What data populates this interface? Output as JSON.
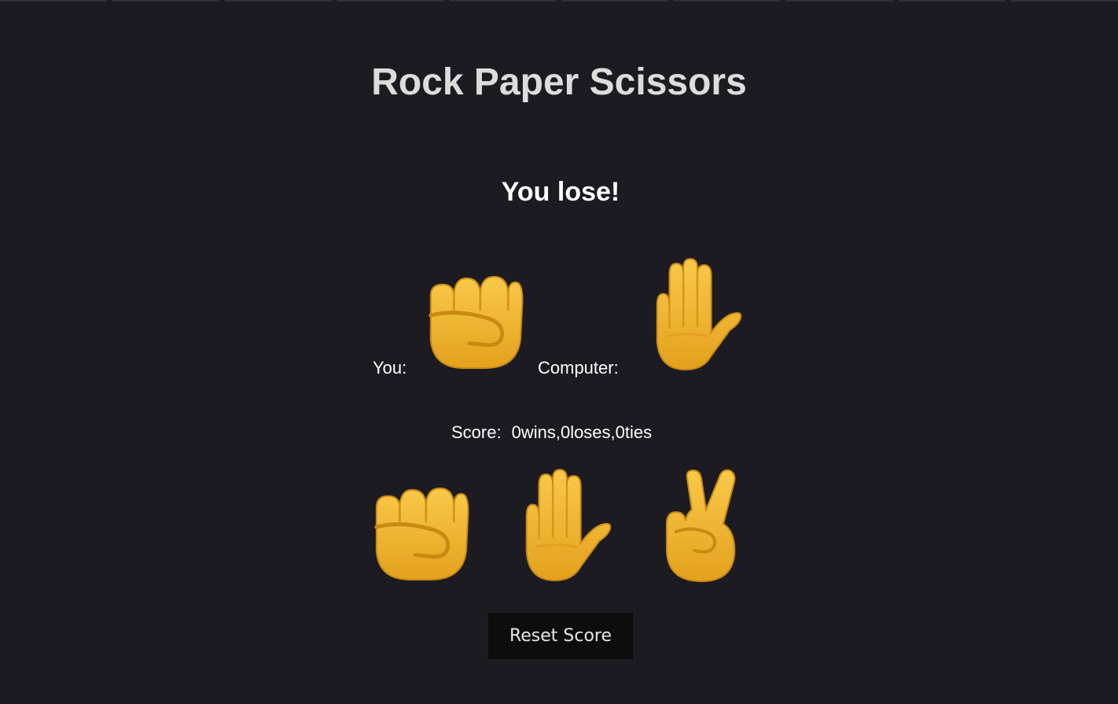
{
  "title": "Rock Paper Scissors",
  "result": "You lose!",
  "moves": {
    "you_label": "You:",
    "you_choice_icon": "rock-fist-icon",
    "computer_label": "Computer:",
    "computer_choice_icon": "paper-hand-icon"
  },
  "score": {
    "label": "Score:",
    "value": "0wins,0loses,0ties"
  },
  "choices": [
    {
      "name": "rock",
      "icon": "rock-fist-icon"
    },
    {
      "name": "paper",
      "icon": "paper-hand-icon"
    },
    {
      "name": "scissors",
      "icon": "scissors-victory-hand-icon"
    }
  ],
  "reset_label": "Reset Score",
  "colors": {
    "background": "#1c1b22",
    "title": "#dcdcdc",
    "text": "#ffffff",
    "button_bg": "#0d0d0e",
    "skin": "#f2b42b",
    "skin_dark": "#c98a12"
  }
}
